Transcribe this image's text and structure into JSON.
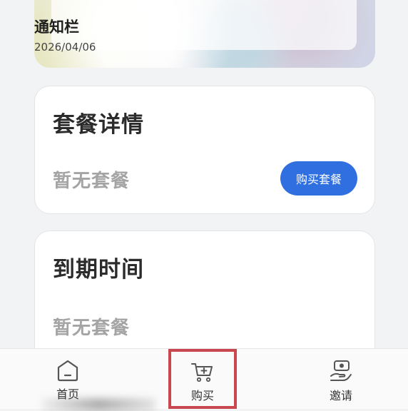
{
  "notice": {
    "title": "通知栏",
    "date": "2026/04/06"
  },
  "plan_card": {
    "title": "套餐详情",
    "status": "暂无套餐",
    "button_label": "购买套餐"
  },
  "expiry_card": {
    "title": "到期时间",
    "status": "暂无套餐"
  },
  "tabbar": {
    "items": [
      {
        "label": "首页",
        "icon": "home-icon"
      },
      {
        "label": "购买",
        "icon": "cart-icon",
        "highlighted": true
      },
      {
        "label": "邀请",
        "icon": "invite-icon"
      }
    ]
  },
  "colors": {
    "accent": "#2f6fe0",
    "highlight_box": "#c9474e"
  }
}
